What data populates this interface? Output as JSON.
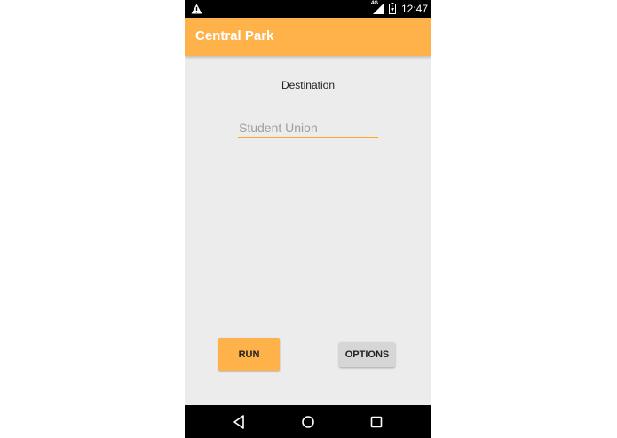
{
  "status_bar": {
    "network_type": "4G",
    "time": "12:47",
    "icons": [
      "warning-icon",
      "signal-icon",
      "battery-icon"
    ]
  },
  "app_bar": {
    "title": "Central Park",
    "color": "#ffb14a"
  },
  "form": {
    "destination_label": "Destination",
    "destination_value": "",
    "destination_placeholder": "Student Union"
  },
  "buttons": {
    "run_label": "RUN",
    "options_label": "OPTIONS"
  },
  "nav_bar": {
    "icons": [
      "back-icon",
      "home-icon",
      "recents-icon"
    ]
  },
  "colors": {
    "accent": "#ffb14a",
    "background": "#ececec",
    "input_underline": "#ffa726",
    "secondary_button": "#d6d6d6"
  }
}
